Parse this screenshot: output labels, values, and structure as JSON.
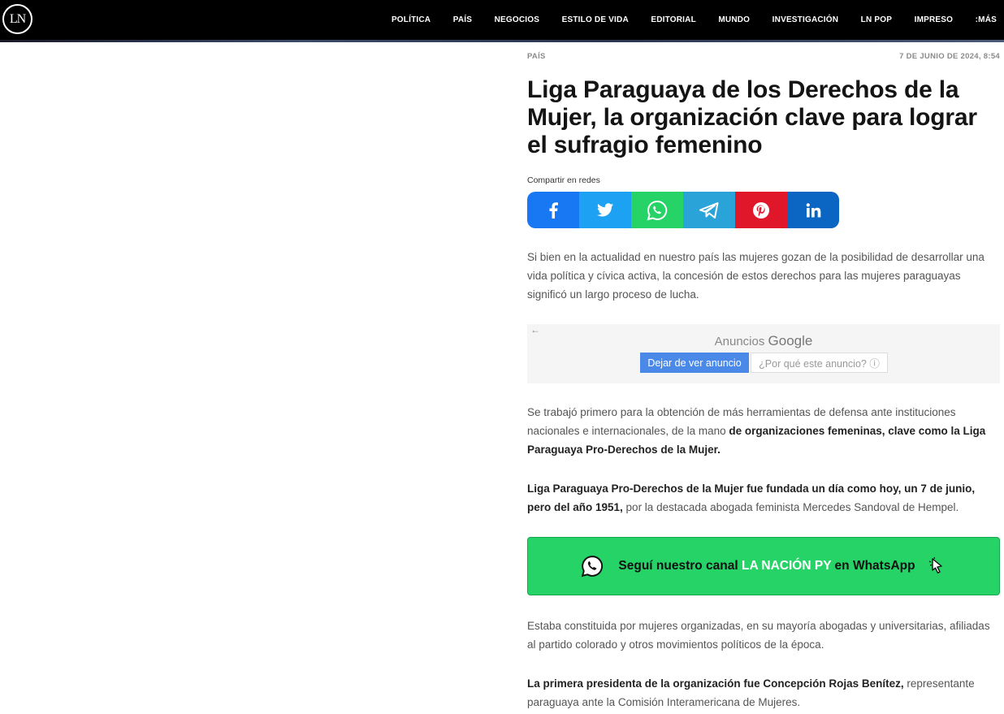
{
  "header": {
    "logo": "LN",
    "nav": [
      "POLÍTICA",
      "PAÍS",
      "NEGOCIOS",
      "ESTILO DE VIDA",
      "EDITORIAL",
      "MUNDO",
      "INVESTIGACIÓN",
      "LN POP",
      "IMPRESO",
      ":MÁS"
    ]
  },
  "article": {
    "section": "PAÍS",
    "date": "7 DE JUNIO DE 2024, 8:54",
    "title": "Liga Paraguaya de los Derechos de la Mujer, la organización clave para lograr el sufragio femenino",
    "share_label": "Compartir en redes",
    "share_icons": [
      "facebook-icon",
      "twitter-icon",
      "whatsapp-icon",
      "telegram-icon",
      "pinterest-icon",
      "linkedin-icon"
    ],
    "p1": "Si bien en la actualidad en nuestro país las mujeres gozan de la posibilidad de desarrollar una vida política y cívica activa, la concesión de estos derechos para las mujeres paraguayas significó un largo proceso de lucha.",
    "ad": {
      "back": "←",
      "label": "Anuncios",
      "brand": "Google",
      "stop": "Dejar de ver anuncio",
      "why": "¿Por qué este anuncio? ⓘ"
    },
    "p2_a": "Se trabajó primero para la obtención de más herramientas de defensa ante instituciones nacionales e internacionales, de la mano ",
    "p2_b": "de organizaciones femeninas, clave como la Liga Paraguaya Pro-Derechos de la Mujer.",
    "p3_a": "Liga Paraguaya Pro-Derechos de la Mujer fue fundada un día como hoy, un 7 de junio, pero del año 1951,",
    "p3_b": " por la destacada abogada feminista Mercedes Sandoval de Hempel.",
    "wa_banner": {
      "pre": "Seguí nuestro canal ",
      "highlight": "LA NACIÓN PY",
      "post": " en WhatsApp"
    },
    "p4": "Estaba constituida por mujeres organizadas, en su mayoría abogadas y universitarias, afiliadas al partido colorado y otros movimientos políticos de la época.",
    "p5_a": "La primera presidenta de la organización fue Concepción Rojas Benítez,",
    "p5_b": " representante paraguaya ante la Comisión Interamericana de Mujeres."
  },
  "colors": {
    "facebook": "#1877f2",
    "twitter": "#1da1f2",
    "whatsapp": "#25d366",
    "telegram": "#2aa3d9",
    "pinterest": "#e0162b",
    "linkedin": "#0a66c2"
  }
}
